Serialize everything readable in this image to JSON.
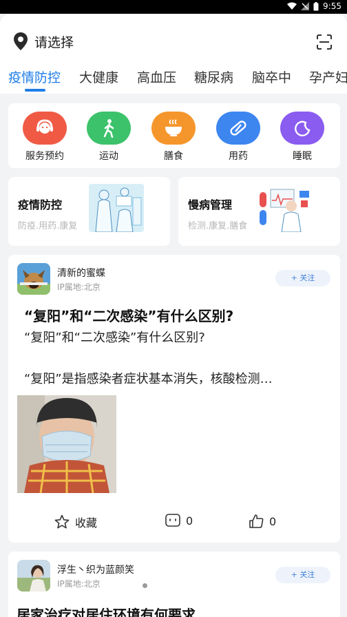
{
  "status_bar": {
    "time": "9:55"
  },
  "location": {
    "label": "请选择"
  },
  "tabs": [
    {
      "label": "疫情防控"
    },
    {
      "label": "大健康"
    },
    {
      "label": "高血压"
    },
    {
      "label": "糖尿病"
    },
    {
      "label": "脑卒中"
    },
    {
      "label": "孕产妇"
    }
  ],
  "services": [
    {
      "label": "服务预约",
      "color": "#f05a45"
    },
    {
      "label": "运动",
      "color": "#3cc26b"
    },
    {
      "label": "膳食",
      "color": "#f5962c"
    },
    {
      "label": "用药",
      "color": "#3d86f0"
    },
    {
      "label": "睡眠",
      "color": "#8a5cf0"
    }
  ],
  "promos": [
    {
      "title": "疫情防控",
      "subtitle": "防疫.用药.康复"
    },
    {
      "title": "慢病管理",
      "subtitle": "检测.康复.膳食"
    }
  ],
  "posts": [
    {
      "author": "清新的蜜蝶",
      "ip": "IP属地:北京",
      "follow_label": "+ 关注",
      "title": "“复阳”和“二次感染”有什么区别?",
      "body_line1": "“复阳”和“二次感染”有什么区别?",
      "body_line2": "“复阳”是指感染者症状基本消失，核酸检测…",
      "actions": {
        "favorite_label": "收藏",
        "comment_count": "0",
        "like_count": "0"
      }
    },
    {
      "author": "浮生丶织为蓝颜笑",
      "ip": "IP属地:北京",
      "follow_label": "+ 关注",
      "title": "居家治疗对居住环境有何要求"
    }
  ]
}
